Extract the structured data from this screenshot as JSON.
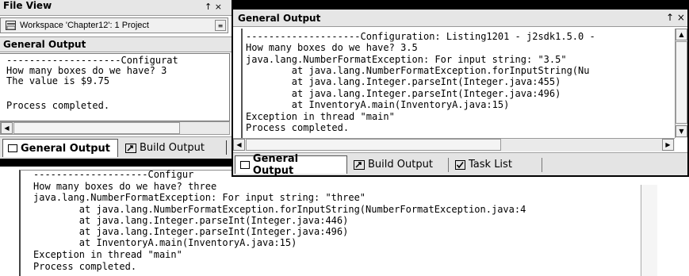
{
  "left_panel": {
    "file_view_title": "File View",
    "pin_close": "↑ ×",
    "workspace_label": "Workspace 'Chapter12': 1 Project",
    "general_output_title": "General Output",
    "output_lines": [
      "--------------------Configurat",
      "How many boxes do we have? 3",
      "The value is $9.75",
      "",
      "Process completed."
    ],
    "tabs": {
      "general_output": "General Output",
      "build_output": "Build Output"
    }
  },
  "bottom_panel": {
    "output_lines": [
      "--------------------Configur",
      "How many boxes do we have? three",
      "java.lang.NumberFormatException: For input string: \"three\"",
      "        at java.lang.NumberFormatException.forInputString(NumberFormatException.java:4",
      "        at java.lang.Integer.parseInt(Integer.java:446)",
      "        at java.lang.Integer.parseInt(Integer.java:496)",
      "        at InventoryA.main(InventoryA.java:15)",
      "Exception in thread \"main\"",
      "Process completed."
    ]
  },
  "right_panel": {
    "title": "General Output",
    "pin_close": "↑ ×",
    "output_lines": [
      "--------------------Configuration: Listing1201 - j2sdk1.5.0 -",
      "How many boxes do we have? 3.5",
      "java.lang.NumberFormatException: For input string: \"3.5\"",
      "        at java.lang.NumberFormatException.forInputString(Nu",
      "        at java.lang.Integer.parseInt(Integer.java:455)",
      "        at java.lang.Integer.parseInt(Integer.java:496)",
      "        at InventoryA.main(InventoryA.java:15)",
      "Exception in thread \"main\"",
      "Process completed."
    ],
    "tabs": {
      "general_output": "General Output",
      "build_output": "Build Output",
      "task_list": "Task List"
    }
  }
}
